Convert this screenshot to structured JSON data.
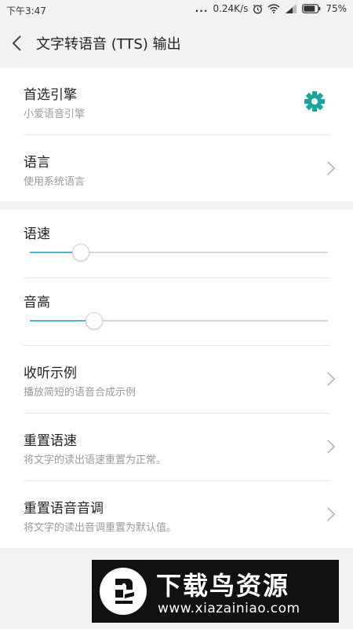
{
  "status_bar": {
    "time": "下午3:47",
    "dots": "...",
    "speed": "0.24K/s",
    "battery": "75%",
    "icons": [
      "alarm-icon",
      "wifi-icon",
      "signal-icon",
      "battery-icon"
    ]
  },
  "header": {
    "title": "文字转语音 (TTS) 输出",
    "back_icon": "back-arrow-icon"
  },
  "engine": {
    "title": "首选引擎",
    "subtitle": "小爱语音引擎",
    "icon": "gear-icon",
    "accent": "#1aa59a"
  },
  "language": {
    "title": "语言",
    "subtitle": "使用系统语言"
  },
  "speech_rate": {
    "title": "语速",
    "level": 0.17
  },
  "pitch": {
    "title": "音高",
    "level": 0.215
  },
  "slider_color": "#4ab8c8",
  "listen_example": {
    "title": "收听示例",
    "subtitle": "播放简短的语音合成示例"
  },
  "reset_rate": {
    "title": "重置语速",
    "subtitle": "将文字的读出语速重置为正常。"
  },
  "reset_pitch": {
    "title": "重置语音音调",
    "subtitle": "将文字的读出音调重置为默认值。"
  },
  "watermark": {
    "title": "下载鸟资源",
    "url": "www.xiazainiao.com"
  }
}
